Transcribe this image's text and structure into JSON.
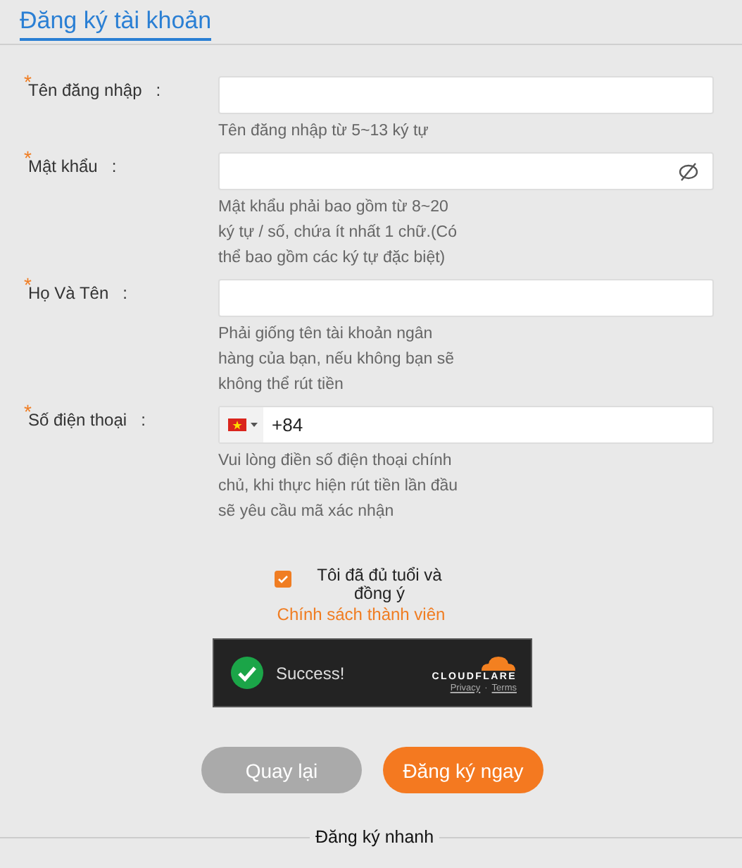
{
  "title": "Đăng ký tài khoản",
  "fields": [
    {
      "kind": "text",
      "required_mark": "*",
      "label": "Tên đăng nhập",
      "colon": ":",
      "hint": "Tên đăng nhập từ 5~13 ký tự"
    },
    {
      "kind": "password",
      "required_mark": "*",
      "label": "Mật khẩu",
      "colon": ":",
      "hint": "Mật khẩu phải bao gồm từ 8~20 ký tự / số, chứa ít nhất 1 chữ.(Có thể bao gồm các ký tự đặc biệt)"
    },
    {
      "kind": "text",
      "required_mark": "*",
      "label": "Họ Và Tên",
      "colon": ":",
      "hint": "Phải giống tên tài khoản ngân hàng của bạn, nếu không bạn sẽ không thể rút tiền"
    },
    {
      "kind": "phone",
      "required_mark": "*",
      "label": "Số điện thoại",
      "colon": ":",
      "value": "+84",
      "hint": "Vui lòng điền số điện thoại chính chủ, khi thực hiện rút tiền lần đầu sẽ yêu cầu mã xác nhận"
    }
  ],
  "agreement": {
    "checked": true,
    "text": "Tôi đã đủ tuổi và đồng ý",
    "link": "Chính sách thành viên"
  },
  "captcha": {
    "status": "Success!",
    "brand": "CLOUDFLARE",
    "links": [
      "Privacy",
      "Terms"
    ],
    "separator": "·"
  },
  "buttons": [
    {
      "kind": "secondary",
      "label": "Quay lại"
    },
    {
      "kind": "primary",
      "label": "Đăng ký ngay"
    }
  ],
  "quick_register": "Đăng ký nhanh"
}
